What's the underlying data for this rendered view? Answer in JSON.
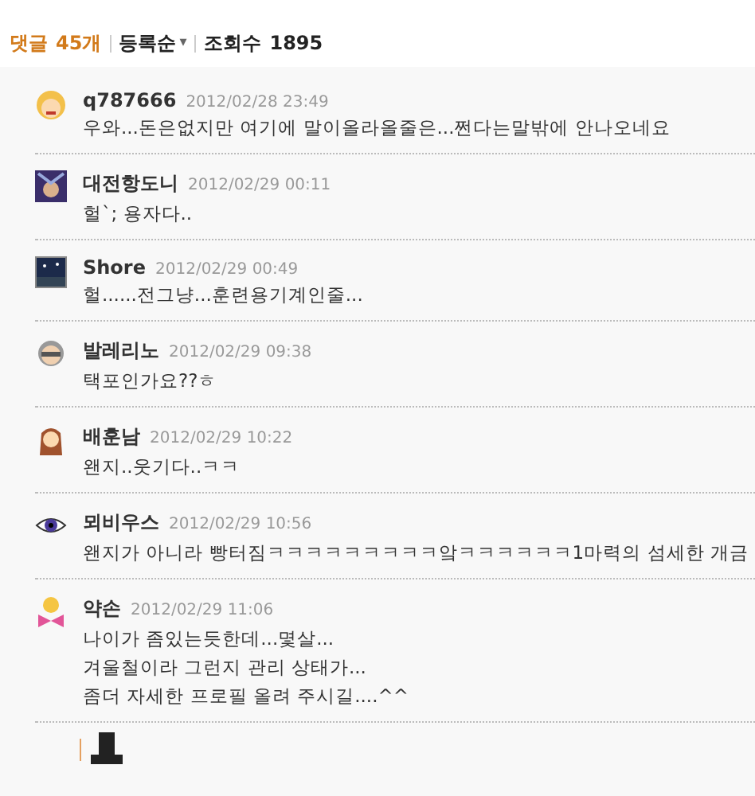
{
  "header": {
    "comment_label": "댓글",
    "comment_count": "45개",
    "sort": "등록순",
    "sort_caret": "▾",
    "views_label": "조회수",
    "views": "1895"
  },
  "comments": [
    {
      "kind": "blonde",
      "author": "q787666",
      "date": "2012/02/28 23:49",
      "lines": [
        "우와...돈은없지만 여기에 말이올라올줄은...쩐다는말밖에 안나오네요"
      ]
    },
    {
      "kind": "spiky",
      "author": "대전항도니",
      "date": "2012/02/29 00:11",
      "lines": [
        "헐`; 용자다.."
      ]
    },
    {
      "kind": "night",
      "author": "Shore",
      "date": "2012/02/29 00:49",
      "lines": [
        "헐......전그냥...훈련용기계인줄..."
      ]
    },
    {
      "kind": "glasses",
      "author": "발레리노",
      "date": "2012/02/29 09:38",
      "lines": [
        "택포인가요??ㅎ"
      ]
    },
    {
      "kind": "girl",
      "author": "배훈남",
      "date": "2012/02/29 10:22",
      "lines": [
        "왠지..웃기다..ㅋㅋ"
      ]
    },
    {
      "kind": "eye",
      "author": "뫼비우스",
      "date": "2012/02/29 10:56",
      "lines": [
        "왠지가 아니라 빵터짐ㅋㅋㅋㅋㅋㅋㅋㅋㅋ앜ㅋㅋㅋㅋㅋㅋ1마력의 섬세한 개금"
      ]
    },
    {
      "kind": "bow",
      "author": "약손",
      "date": "2012/02/29 11:06",
      "lines": [
        "나이가 좀있는듯한데...몇살...",
        "겨울철이라 그런지 관리 상태가...",
        "좀더 자세한 프로필 올려 주시길....^^"
      ]
    }
  ],
  "reply_stub": {
    "kind": "hat"
  }
}
